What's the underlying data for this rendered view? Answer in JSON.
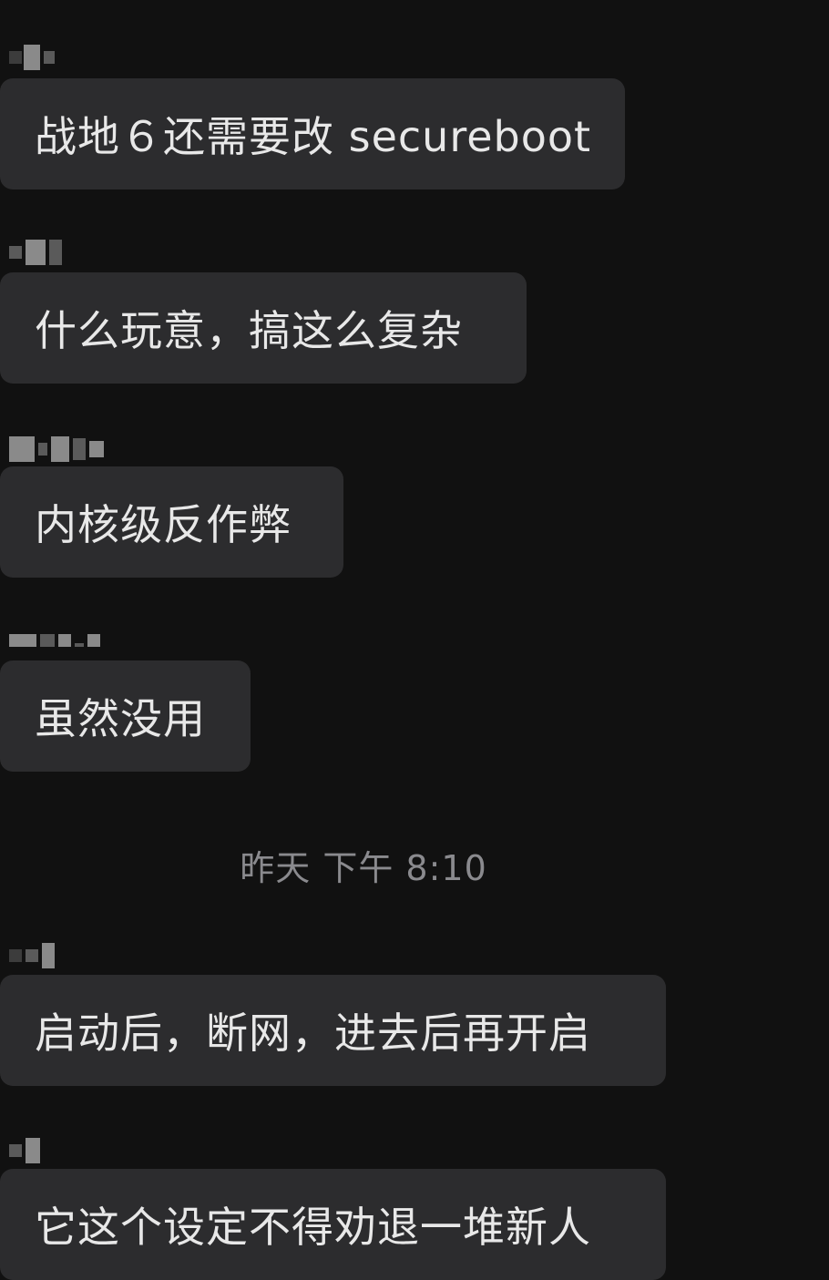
{
  "messages": [
    {
      "text": "战地６还需要改 secureboot"
    },
    {
      "text": "什么玩意，搞这么复杂"
    },
    {
      "text": "内核级反作弊"
    },
    {
      "text": "虽然没用"
    },
    {
      "text": "启动后，断网，进去后再开启"
    },
    {
      "text": "它这个设定不得劝退一堆新人"
    }
  ],
  "timestamp": "昨天 下午 8:10",
  "colors": {
    "background": "#111111",
    "bubble": "#2c2c2e",
    "text": "#e8e8e8",
    "timestamp": "#8a8a8e"
  }
}
